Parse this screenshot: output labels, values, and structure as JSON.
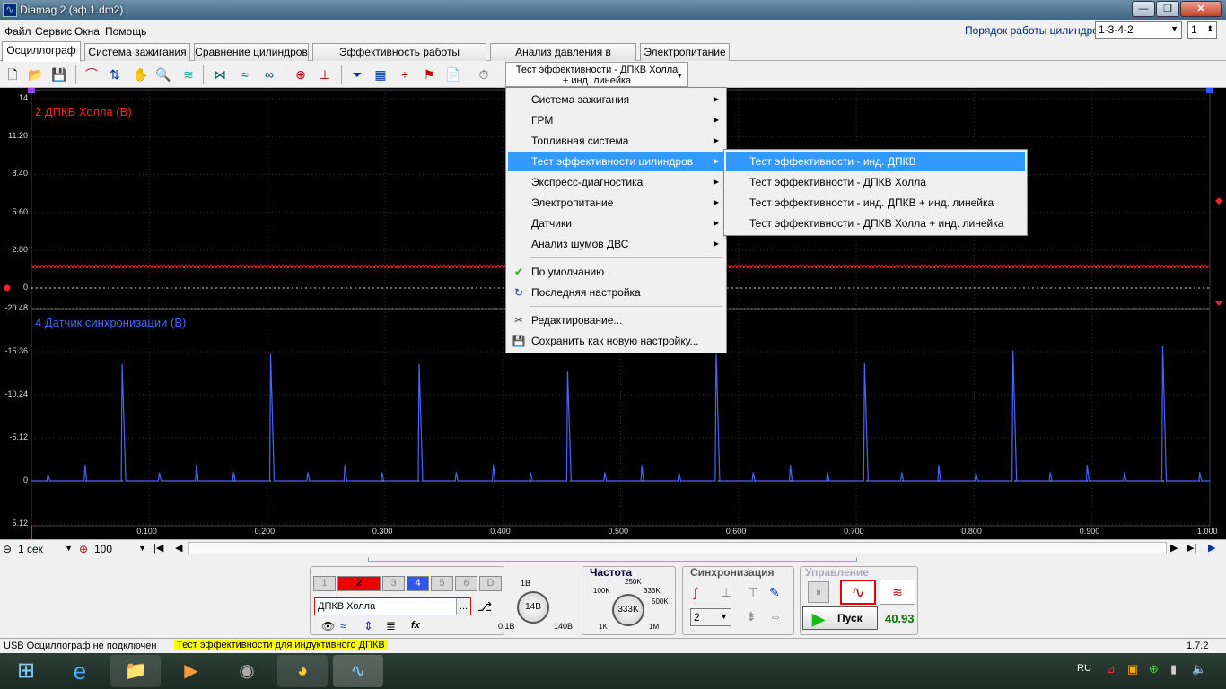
{
  "window": {
    "title": "Diamag 2 (эф.1.dm2)",
    "min": "—",
    "max": "❐",
    "close": "✕"
  },
  "menubar": {
    "items": [
      "Файл",
      "Сервис",
      "Окна",
      "Помощь"
    ],
    "order_label": "Порядок работы цилиндров",
    "order_value": "1-3-4-2",
    "count_value": "1"
  },
  "tabs": [
    "Осциллограф",
    "Система зажигания",
    "Сравнение цилиндров",
    "Эффективность работы цилиндров",
    "Анализ давления в цилиндре",
    "Электропитание"
  ],
  "toolbar": {
    "preset_line1": "Тест эффективности - ДПКВ Холла",
    "preset_line2": "+ инд. линейка"
  },
  "scope": {
    "ch1_label": "2 ДПКВ Холла (В)",
    "ch1_color": "#ff2020",
    "ch2_label": "4 Датчик синхронизации (В)",
    "ch2_color": "#4466ff",
    "marker_left": "1",
    "marker_right": "2"
  },
  "chart_data": {
    "type": "line",
    "x_ticks": [
      "0.100",
      "0.200",
      "0.300",
      "0.400",
      "0.500",
      "0.600",
      "0.700",
      "0.800",
      "0.900",
      "1.000"
    ],
    "xlim": [
      0,
      1.0
    ],
    "panels": [
      {
        "name": "2 ДПКВ Холла (В)",
        "y_ticks": [
          "14",
          "11.20",
          "8.40",
          "5.60",
          "2.80",
          "0"
        ],
        "ylim": [
          0,
          14
        ],
        "level": 1.6
      },
      {
        "name": "4 Датчик синхронизации (В)",
        "y_ticks": [
          "-20.48",
          "-15.36",
          "-10.24",
          "-5.12",
          "0",
          "5.12"
        ],
        "ylim": [
          -20.48,
          5.12
        ],
        "major_peaks_x": [
          0.077,
          0.203,
          0.329,
          0.455,
          0.581,
          0.707,
          0.833,
          0.96
        ],
        "major_peak_values": [
          -13.9,
          -15.1,
          -13.9,
          -13.0,
          -15.6,
          -14.0,
          -15.5,
          -16.0
        ]
      }
    ]
  },
  "nav": {
    "time_value": "1 сек",
    "zoom_value": "100"
  },
  "bottom": {
    "channels": [
      "1",
      "2",
      "3",
      "4",
      "5",
      "6",
      "D"
    ],
    "channel_name": "ДПКВ Холла",
    "channel_menu_btn": "...",
    "volt_knob": {
      "value": "14В",
      "label_top": "1В",
      "label_bl": "0.1В",
      "label_br": "140В"
    },
    "freq_title": "Частота",
    "freq_knob": {
      "value": "333K",
      "labels": [
        "100K",
        "250K",
        "333K",
        "500K",
        "1K",
        "1M"
      ]
    },
    "sync_title": "Синхронизация",
    "sync_value": "2",
    "control_title": "Управление",
    "start_label": "Пуск",
    "counter": "40.93"
  },
  "status": {
    "left": "USB Осциллограф не подключен",
    "mid": "Тест эффективности для индуктивного ДПКВ",
    "version": "1.7.2"
  },
  "menu": {
    "items": [
      "Система зажигания",
      "ГРМ",
      "Топливная система",
      "Тест эффективности цилиндров",
      "Экспресс-диагностика",
      "Электропитание",
      "Датчики",
      "Анализ шумов ДВС"
    ],
    "default": "По умолчанию",
    "last": "Последняя настройка",
    "edit": "Редактирование...",
    "save": "Сохранить как новую настройку..."
  },
  "submenu": {
    "items": [
      "Тест эффективности - инд. ДПКВ",
      "Тест эффективности - ДПКВ Холла",
      "Тест эффективности - инд. ДПКВ + инд. линейка",
      "Тест эффективности - ДПКВ Холла + инд. линейка"
    ]
  },
  "taskbar": {
    "lang": "RU"
  }
}
